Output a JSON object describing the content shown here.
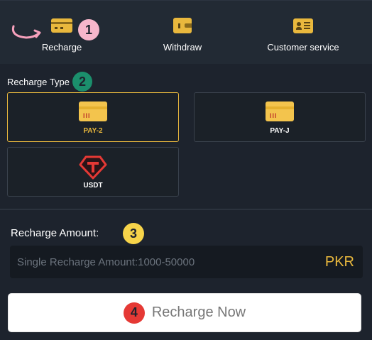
{
  "nav": {
    "items": [
      {
        "label": "Recharge",
        "icon": "bank-card-icon"
      },
      {
        "label": "Withdraw",
        "icon": "wallet-icon"
      },
      {
        "label": "Customer service",
        "icon": "id-card-icon"
      }
    ]
  },
  "badges": {
    "one": "1",
    "two": "2",
    "three": "3",
    "four": "4"
  },
  "recharge_type": {
    "title": "Recharge Type",
    "options": [
      {
        "label": "PAY-2",
        "selected": true
      },
      {
        "label": "PAY-J",
        "selected": false
      },
      {
        "label": "USDT",
        "selected": false
      }
    ]
  },
  "amount": {
    "label": "Recharge Amount:",
    "placeholder": "Single Recharge Amount:1000-50000",
    "currency": "PKR"
  },
  "action": {
    "label": "Recharge Now"
  },
  "colors": {
    "accent": "#e9b83d",
    "badge_pink": "#f7b6cb",
    "badge_green": "#1b8f6c",
    "badge_yellow": "#f7d44a",
    "badge_red": "#e53935",
    "usdt_red": "#e53935"
  }
}
